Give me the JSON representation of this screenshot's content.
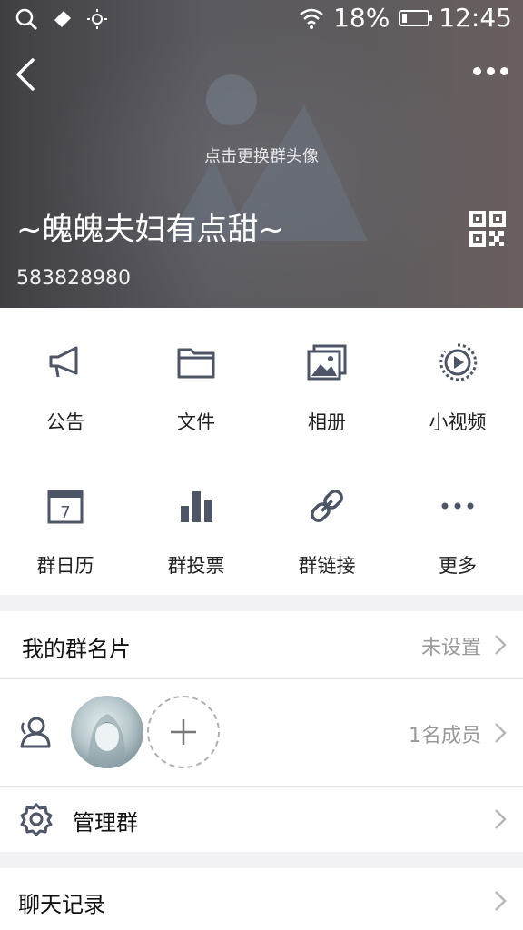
{
  "status_bar": {
    "battery": "18%",
    "time": "12:45"
  },
  "header": {
    "avatar_hint": "点击更换群头像",
    "group_name": "~魄魄夫妇有点甜~",
    "group_id": "583828980"
  },
  "features": [
    {
      "label": "公告",
      "icon": "megaphone-icon"
    },
    {
      "label": "文件",
      "icon": "folder-icon"
    },
    {
      "label": "相册",
      "icon": "album-icon"
    },
    {
      "label": "小视频",
      "icon": "video-icon"
    },
    {
      "label": "群日历",
      "icon": "calendar-icon",
      "day": "7"
    },
    {
      "label": "群投票",
      "icon": "bar-chart-icon"
    },
    {
      "label": "群链接",
      "icon": "link-icon"
    },
    {
      "label": "更多",
      "icon": "more-icon"
    }
  ],
  "card": {
    "label": "我的群名片",
    "value": "未设置"
  },
  "members": {
    "count": "1名成员"
  },
  "manage": {
    "label": "管理群"
  },
  "history": {
    "label": "聊天记录"
  },
  "colors": {
    "icon": "#4d5566",
    "divider": "#e6e6e8",
    "secondary": "#999999"
  }
}
